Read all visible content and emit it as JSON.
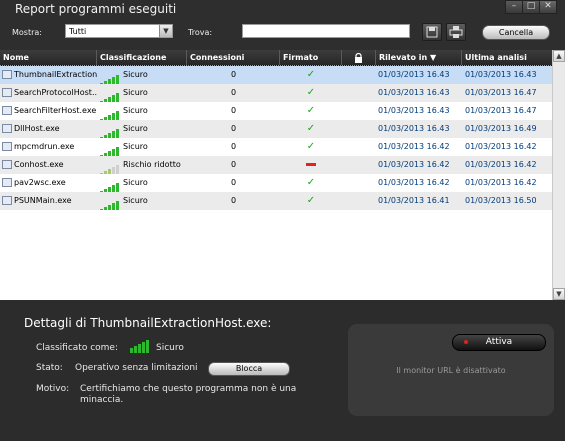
{
  "window": {
    "title": "Report programmi eseguiti",
    "minimize": "–",
    "maximize": "□",
    "close": "✕"
  },
  "toolbar": {
    "show_label": "Mostra:",
    "show_value": "Tutti",
    "find_label": "Trova:",
    "search_value": "",
    "save_icon": "save-icon",
    "print_icon": "print-icon",
    "cancel_label": "Cancella"
  },
  "table": {
    "columns": [
      "Nome",
      "Classificazione",
      "Connessioni",
      "Firmato",
      "",
      "Rilevato in",
      "Ultima analisi"
    ],
    "sort_indicator": "▼",
    "rows": [
      {
        "name": "ThumbnailExtraction...",
        "class": "Sicuro",
        "level": 5,
        "conn": "0",
        "signed": "yes",
        "detected": "01/03/2013 16.43",
        "last": "01/03/2013 16.43",
        "selected": true
      },
      {
        "name": "SearchProtocolHost...",
        "class": "Sicuro",
        "level": 5,
        "conn": "0",
        "signed": "yes",
        "detected": "01/03/2013 16.43",
        "last": "01/03/2013 16.47",
        "selected": false
      },
      {
        "name": "SearchFilterHost.exe",
        "class": "Sicuro",
        "level": 5,
        "conn": "0",
        "signed": "yes",
        "detected": "01/03/2013 16.43",
        "last": "01/03/2013 16.47",
        "selected": false
      },
      {
        "name": "DllHost.exe",
        "class": "Sicuro",
        "level": 5,
        "conn": "0",
        "signed": "yes",
        "detected": "01/03/2013 16.43",
        "last": "01/03/2013 16.49",
        "selected": false
      },
      {
        "name": "mpcmdrun.exe",
        "class": "Sicuro",
        "level": 5,
        "conn": "0",
        "signed": "yes",
        "detected": "01/03/2013 16.42",
        "last": "01/03/2013 16.42",
        "selected": false
      },
      {
        "name": "Conhost.exe",
        "class": "Rischio ridotto",
        "level": 3,
        "conn": "0",
        "signed": "no",
        "detected": "01/03/2013 16.42",
        "last": "01/03/2013 16.42",
        "selected": false
      },
      {
        "name": "pav2wsc.exe",
        "class": "Sicuro",
        "level": 5,
        "conn": "0",
        "signed": "yes",
        "detected": "01/03/2013 16.42",
        "last": "01/03/2013 16.42",
        "selected": false
      },
      {
        "name": "PSUNMain.exe",
        "class": "Sicuro",
        "level": 5,
        "conn": "0",
        "signed": "yes",
        "detected": "01/03/2013 16.41",
        "last": "01/03/2013 16.50",
        "selected": false
      }
    ]
  },
  "details": {
    "title": "Dettagli di ThumbnailExtractionHost.exe:",
    "classified_label": "Classificato come:",
    "classified_value": "Sicuro",
    "status_label": "Stato:",
    "status_value": "Operativo senza limitazioni",
    "block_label": "Blocca",
    "reason_label": "Motivo:",
    "reason_value": "Certifichiamo che questo programma non è una minaccia."
  },
  "url_monitor": {
    "button_label": "Attiva",
    "status_text": "Il monitor URL è disattivato"
  },
  "colors": {
    "selected_row": "#c7dcf5",
    "alt_row": "#ebebeb",
    "safe_bars": "#2db82d",
    "low_risk_bars": "#a6c96a",
    "signed_check": "#1fa51f",
    "unsigned_dash": "#e52222"
  }
}
